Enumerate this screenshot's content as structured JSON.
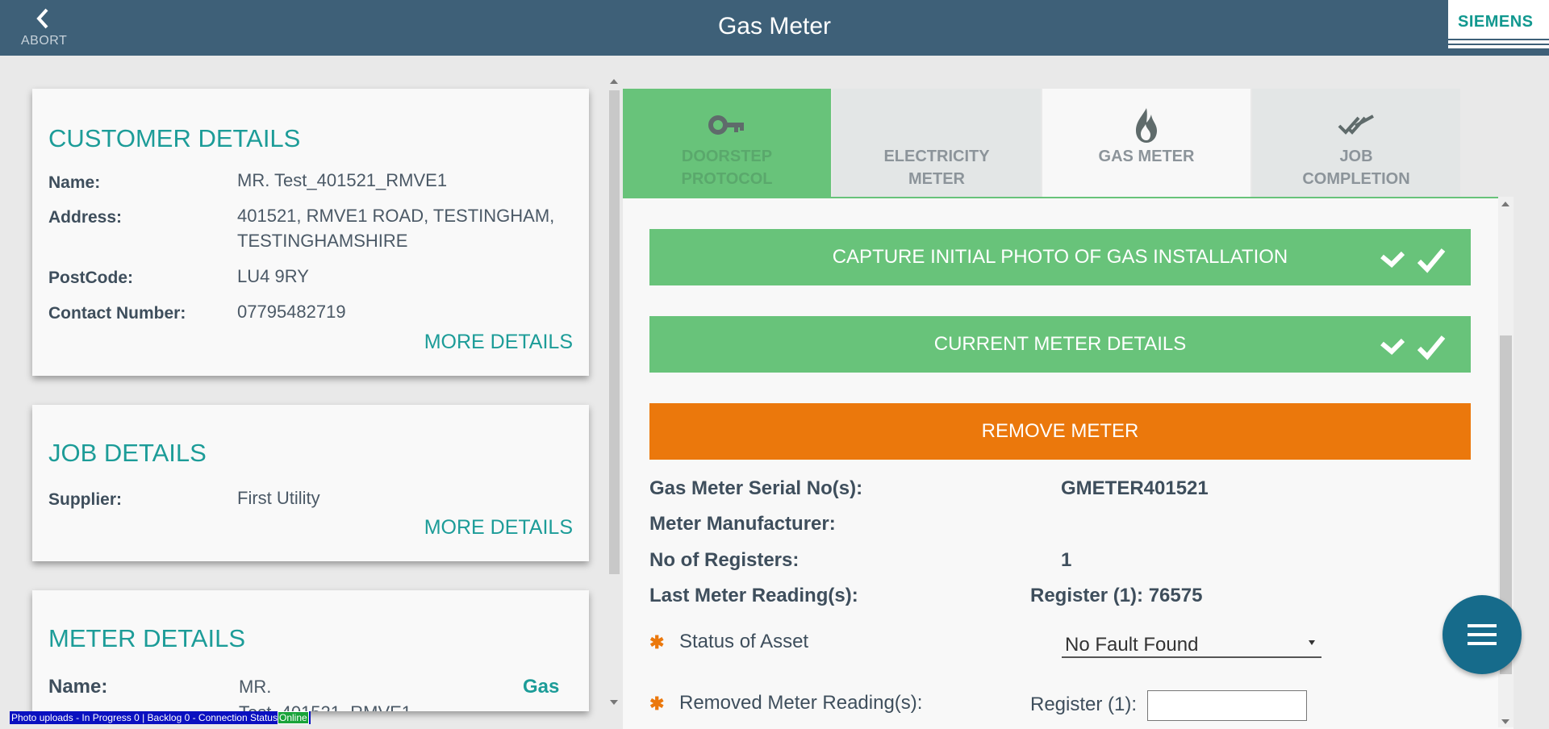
{
  "header": {
    "title": "Gas Meter",
    "abort_label": "ABORT",
    "brand": "SIEMENS"
  },
  "customer": {
    "heading": "CUSTOMER DETAILS",
    "name_label": "Name:",
    "name": "MR. Test_401521_RMVE1",
    "address_label": "Address:",
    "address_line1": "401521, RMVE1 ROAD, TESTINGHAM,",
    "address_line2": "TESTINGHAMSHIRE",
    "postcode_label": "PostCode:",
    "postcode": "LU4 9RY",
    "contact_label": "Contact Number:",
    "contact": "07795482719",
    "more": "MORE DETAILS"
  },
  "job": {
    "heading": "JOB DETAILS",
    "supplier_label": "Supplier:",
    "supplier": "First Utility",
    "more": "MORE DETAILS"
  },
  "meter": {
    "heading": "METER DETAILS",
    "name_label": "Name:",
    "name_line1": "MR.",
    "name_line2": "Test_401521_RMVE1",
    "type": "Gas"
  },
  "tabs": [
    {
      "line1": "DOORSTEP",
      "line2": "PROTOCOL",
      "state": "done",
      "icon": "key-icon"
    },
    {
      "line1": "ELECTRICITY",
      "line2": "METER",
      "state": "inactive",
      "icon": ""
    },
    {
      "line1": "GAS METER",
      "line2": "",
      "state": "active",
      "icon": "flame-icon"
    },
    {
      "line1": "JOB",
      "line2": "COMPLETION",
      "state": "inactive",
      "icon": "double-check-icon"
    }
  ],
  "sections": {
    "capture": "CAPTURE INITIAL PHOTO OF GAS INSTALLATION",
    "current": "CURRENT METER DETAILS",
    "remove": "REMOVE METER"
  },
  "fields": {
    "serial_label": "Gas Meter Serial No(s):",
    "serial": "GMETER401521",
    "manufacturer_label": "Meter Manufacturer:",
    "manufacturer": "",
    "registers_label": "No of Registers:",
    "registers": "1",
    "last_label": "Last Meter Reading(s):",
    "last": "Register (1): 76575",
    "status_label": "Status of Asset",
    "status_value": "No Fault Found",
    "removed_label": "Removed Meter Reading(s):",
    "removed_reg_label": "Register (1):",
    "removed_reg_value": ""
  },
  "statusbar": {
    "text": "Photo uploads - In Progress 0 | Backlog 0 - Connection Status",
    "connection": "Online"
  },
  "colors": {
    "header": "#3e6078",
    "teal": "#1c9c98",
    "green": "#68c37a",
    "orange": "#eb780c",
    "fab": "#166b8b"
  }
}
